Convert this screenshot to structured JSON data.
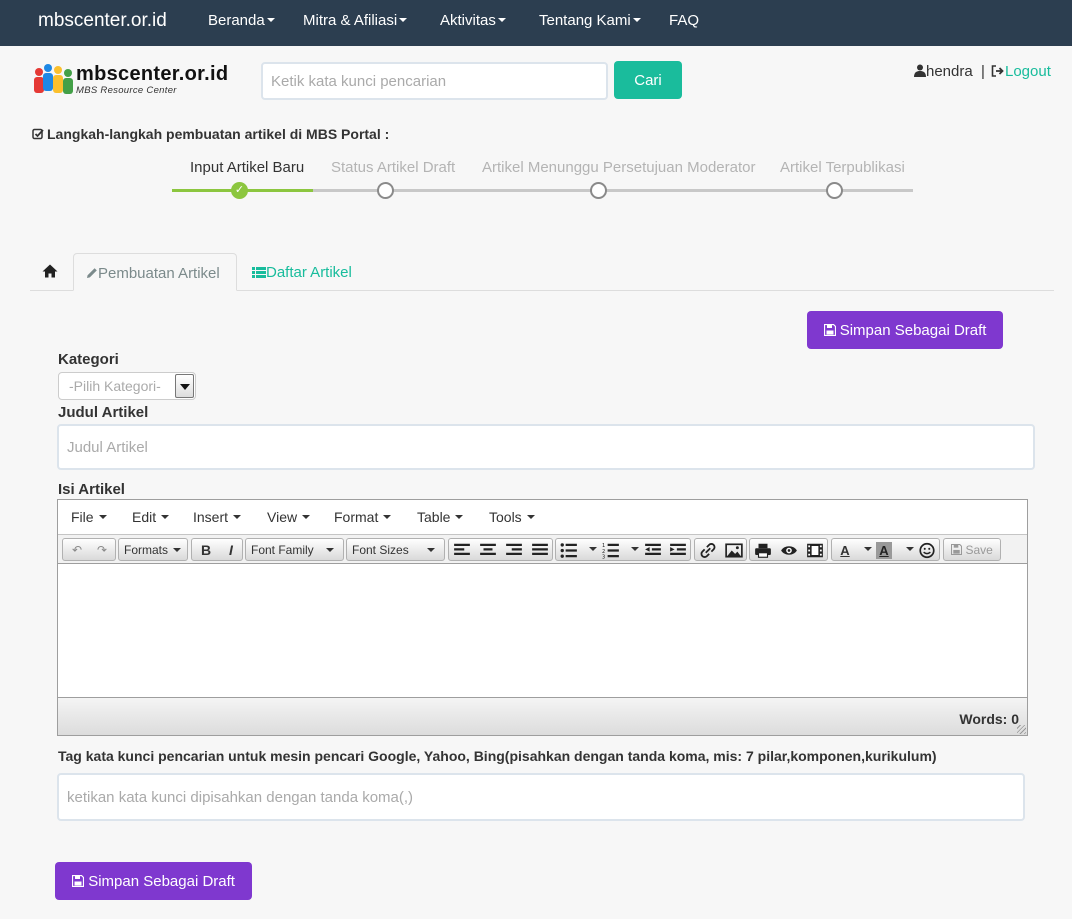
{
  "navbar": {
    "brand": "mbscenter.or.id",
    "items": [
      {
        "label": "Beranda",
        "dropdown": true
      },
      {
        "label": "Mitra & Afiliasi",
        "dropdown": true
      },
      {
        "label": "Aktivitas",
        "dropdown": true
      },
      {
        "label": "Tentang Kami",
        "dropdown": true
      },
      {
        "label": "FAQ",
        "dropdown": false
      }
    ]
  },
  "header": {
    "logo_title": "mbscenter.or.id",
    "logo_subtitle": "MBS Resource Center",
    "search_placeholder": "Ketik kata kunci pencarian",
    "search_button": "Cari",
    "username": "hendra",
    "separator": "|",
    "logout": "Logout"
  },
  "steps": {
    "title": "Langkah-langkah pembuatan artikel di MBS Portal :",
    "items": [
      {
        "label": "Input Artikel Baru",
        "active": true
      },
      {
        "label": "Status Artikel Draft",
        "active": false
      },
      {
        "label": "Artikel Menunggu Persetujuan Moderator",
        "active": false
      },
      {
        "label": "Artikel Terpublikasi",
        "active": false
      }
    ]
  },
  "tabs": {
    "create": "Pembuatan Artikel",
    "list": "Daftar Artikel"
  },
  "form": {
    "save_draft": "Simpan Sebagai Draft",
    "category_label": "Kategori",
    "category_selected": "-Pilih Kategori-",
    "title_label": "Judul Artikel",
    "title_placeholder": "Judul Artikel",
    "content_label": "Isi Artikel",
    "tag_label": "Tag kata kunci pencarian untuk mesin pencari Google, Yahoo, Bing(pisahkan dengan tanda koma, mis: 7 pilar,komponen,kurikulum)",
    "tag_placeholder": "ketikan kata kunci dipisahkan dengan tanda koma(,)"
  },
  "editor": {
    "menu": [
      "File",
      "Edit",
      "Insert",
      "View",
      "Format",
      "Table",
      "Tools"
    ],
    "formats": "Formats",
    "bold": "B",
    "italic": "I",
    "font_family": "Font Family",
    "font_sizes": "Font Sizes",
    "save": "Save",
    "words": "Words: 0"
  },
  "colors": {
    "navbar": "#2c3e50",
    "accent": "#1abc9c",
    "purple": "#7f38cf",
    "progress": "#8cc63f"
  }
}
